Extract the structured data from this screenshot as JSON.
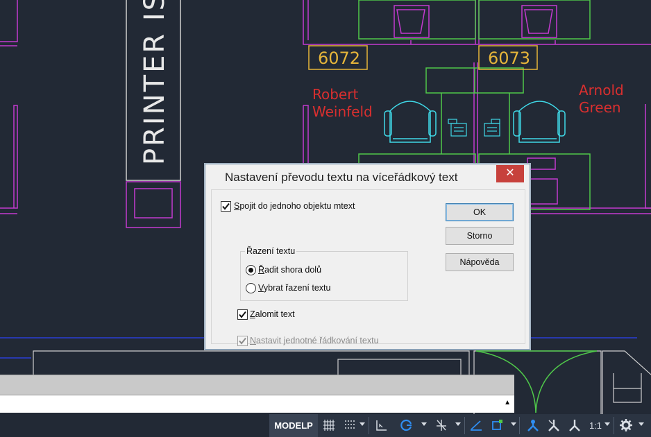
{
  "drawing": {
    "room_6072": "6072",
    "room_6073": "6073",
    "vertical_label": "PRINTER IS",
    "person_left": [
      "Robert",
      "Weinfeld"
    ],
    "person_right": [
      "Arnold",
      "Green"
    ],
    "colors": {
      "background": "#222935",
      "walls": "#c33ad0",
      "furniture": "#4fc84a",
      "chairs": "#3fd9e8",
      "names": "#d92f2f",
      "room_tags": "#e6b53a"
    }
  },
  "dialog": {
    "title": "Nastavení převodu textu na víceřádkový text",
    "close_icon": "close-icon",
    "combine": {
      "label": "Spojit do jednoho objektu mtext",
      "checked": true
    },
    "sort_group": {
      "label": "Řazení textu",
      "options": [
        {
          "label": "Řadit shora dolů",
          "selected": true
        },
        {
          "label": "Vybrat řazení textu",
          "selected": false
        }
      ]
    },
    "wrap": {
      "label": "Zalomit text",
      "checked": true
    },
    "spacing": {
      "label": "Nastavit jednotné řádkování textu",
      "checked": true,
      "disabled": true
    },
    "buttons": {
      "ok": "OK",
      "cancel": "Storno",
      "help": "Nápověda"
    }
  },
  "statusbar": {
    "model": "MODELP",
    "scale": "1:1",
    "icons": [
      "grid-icon",
      "snap-icon",
      "ortho-icon",
      "polar-icon",
      "isodraft-icon",
      "object-snap-tracking-icon",
      "object-snap-icon",
      "annotation-visibility-icon",
      "autoscale-icon",
      "annotation-scale-icon",
      "settings-gear-icon"
    ]
  }
}
